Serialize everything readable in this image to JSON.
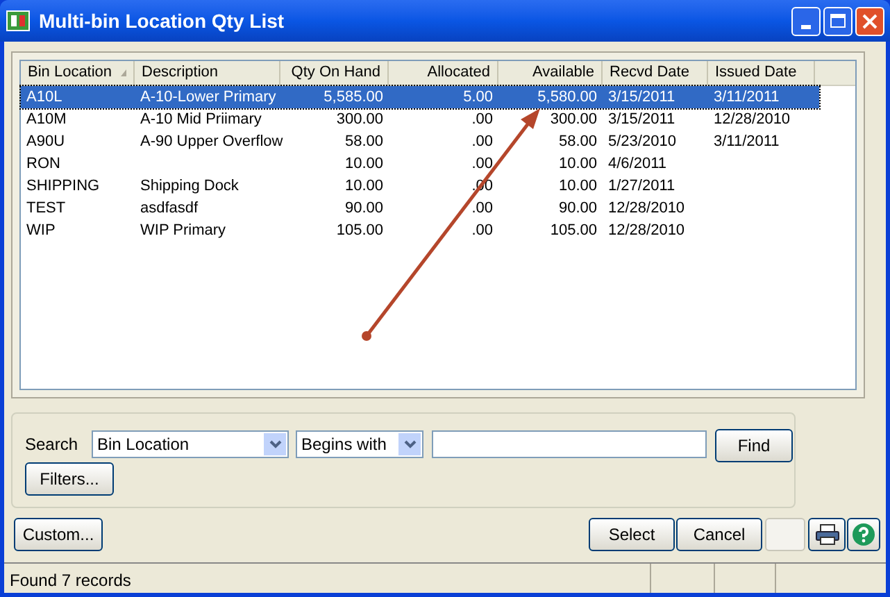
{
  "window": {
    "title": "Multi-bin Location Qty List"
  },
  "table": {
    "columns": [
      {
        "label": "Bin Location",
        "sorted": true,
        "kind": "text"
      },
      {
        "label": "Description",
        "sorted": false,
        "kind": "text"
      },
      {
        "label": "Qty On Hand",
        "sorted": false,
        "kind": "number"
      },
      {
        "label": "Allocated",
        "sorted": false,
        "kind": "number"
      },
      {
        "label": "Available",
        "sorted": false,
        "kind": "number"
      },
      {
        "label": "Recvd Date",
        "sorted": false,
        "kind": "text"
      },
      {
        "label": "Issued Date",
        "sorted": false,
        "kind": "text"
      }
    ],
    "rows": [
      {
        "selected": true,
        "cells": [
          "A10L",
          "A-10-Lower Primary",
          "5,585.00",
          "5.00",
          "5,580.00",
          "3/15/2011",
          "3/11/2011"
        ]
      },
      {
        "selected": false,
        "cells": [
          "A10M",
          "A-10 Mid Priimary",
          "300.00",
          ".00",
          "300.00",
          "3/15/2011",
          "12/28/2010"
        ]
      },
      {
        "selected": false,
        "cells": [
          "A90U",
          "A-90 Upper Overflow",
          "58.00",
          ".00",
          "58.00",
          "5/23/2010",
          "3/11/2011"
        ]
      },
      {
        "selected": false,
        "cells": [
          "RON",
          "",
          "10.00",
          ".00",
          "10.00",
          "4/6/2011",
          ""
        ]
      },
      {
        "selected": false,
        "cells": [
          "SHIPPING",
          "Shipping Dock",
          "10.00",
          ".00",
          "10.00",
          "1/27/2011",
          ""
        ]
      },
      {
        "selected": false,
        "cells": [
          "TEST",
          "asdfasdf",
          "90.00",
          ".00",
          "90.00",
          "12/28/2010",
          ""
        ]
      },
      {
        "selected": false,
        "cells": [
          "WIP",
          "WIP Primary",
          "105.00",
          ".00",
          "105.00",
          "12/28/2010",
          ""
        ]
      }
    ]
  },
  "search": {
    "label": "Search",
    "field": "Bin Location",
    "operator": "Begins with",
    "find_button": "Find",
    "filters_button": "Filters..."
  },
  "buttons": {
    "custom": "Custom...",
    "select": "Select",
    "cancel": "Cancel"
  },
  "status_bar": {
    "text": "Found 7 records"
  }
}
